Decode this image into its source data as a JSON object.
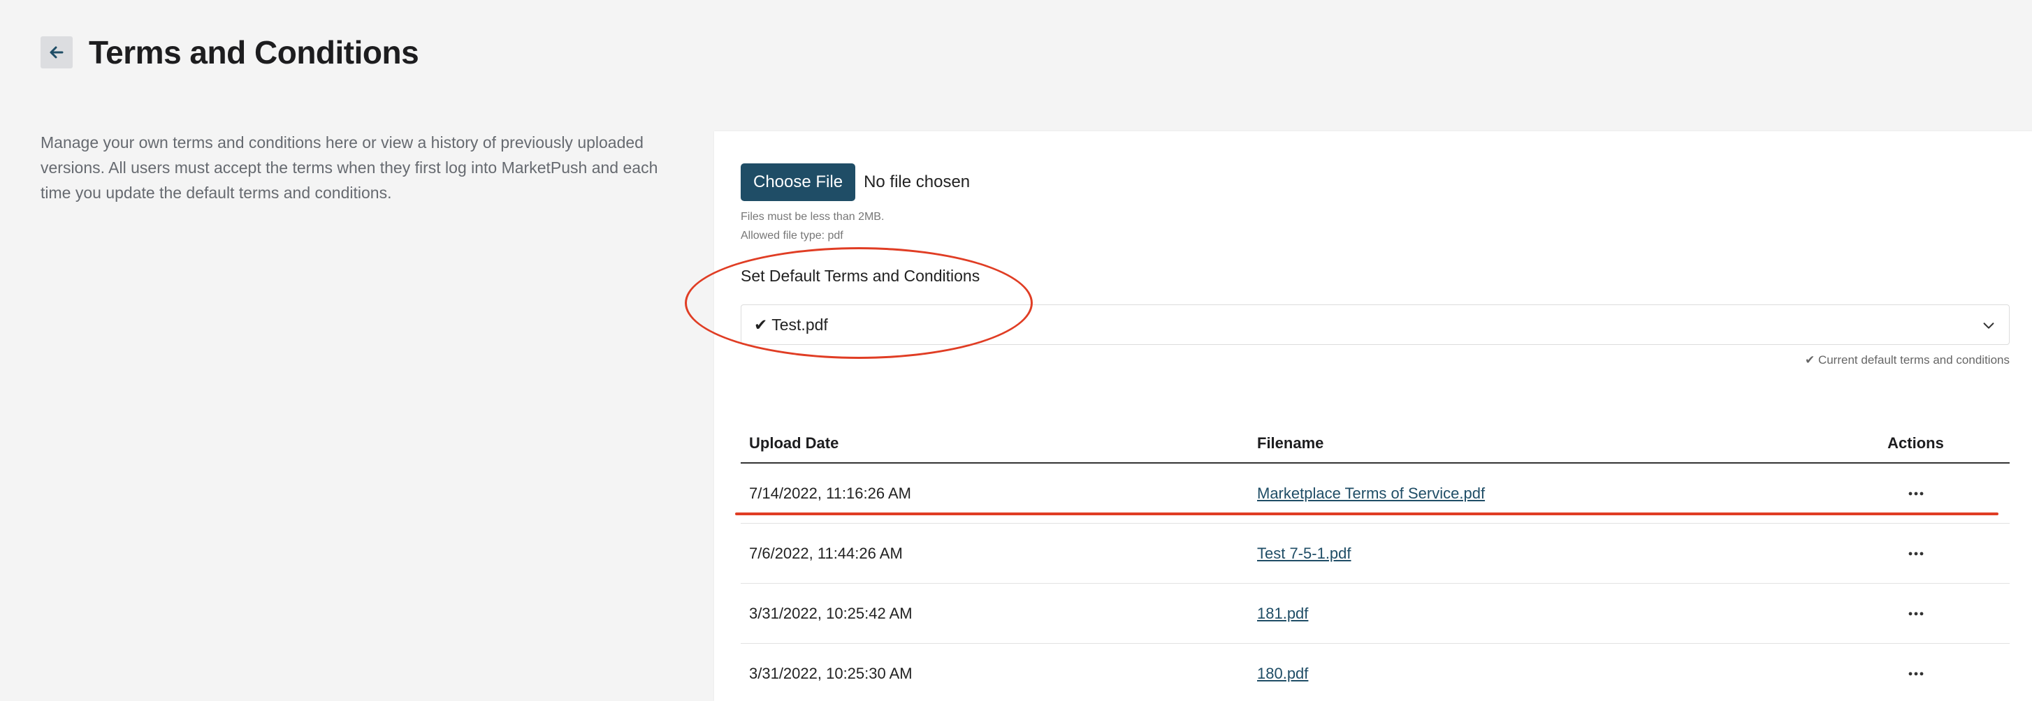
{
  "header": {
    "back_icon": "arrow-left-icon",
    "title": "Terms and Conditions"
  },
  "description": "Manage your own terms and conditions here or view a history of previously uploaded versions. All users must accept the terms when they first log into MarketPush and each time you update the default terms and conditions.",
  "upload": {
    "button_label": "Choose File",
    "status": "No file chosen",
    "hint_size": "Files must be less than 2MB.",
    "hint_type": "Allowed file type: pdf"
  },
  "default_select": {
    "label": "Set Default Terms and Conditions",
    "value": "✔ Test.pdf",
    "chevron_icon": "chevron-down-icon",
    "footnote": "✔ Current default terms and conditions"
  },
  "table": {
    "headers": [
      "Upload Date",
      "Filename",
      "Actions"
    ],
    "rows": [
      {
        "date": "7/14/2022, 11:16:26 AM",
        "filename": "Marketplace Terms of Service.pdf"
      },
      {
        "date": "7/6/2022, 11:44:26 AM",
        "filename": "Test 7-5-1.pdf"
      },
      {
        "date": "3/31/2022, 10:25:42 AM",
        "filename": "181.pdf"
      },
      {
        "date": "3/31/2022, 10:25:30 AM",
        "filename": "180.pdf"
      }
    ],
    "actions_icon": "more-horizontal-icon"
  },
  "colors": {
    "primary": "#1f4d66",
    "annotation": "#e03d24",
    "background": "#f4f4f4"
  }
}
